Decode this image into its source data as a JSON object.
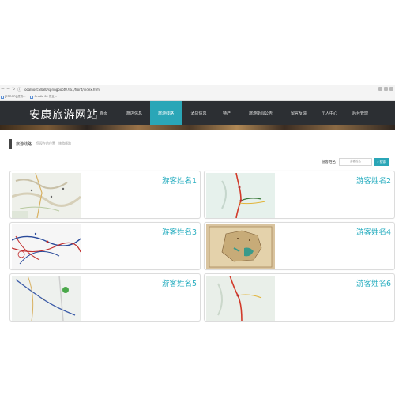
{
  "browser": {
    "url": "localhost:8080/springboot07la1/front/index.html",
    "nav_icons": [
      "back-icon",
      "forward-icon",
      "reload-icon",
      "info-icon"
    ],
    "bookmarks": [
      {
        "label": "[ERROR] 资讯..."
      },
      {
        "label": "Gradle 00 作业..."
      }
    ]
  },
  "site": {
    "logo": "安康旅游网站",
    "menu": [
      {
        "label": "首页",
        "active": false
      },
      {
        "label": "旅店信息",
        "active": false
      },
      {
        "label": "旅游线路",
        "active": true
      },
      {
        "label": "酒店信息",
        "active": false
      },
      {
        "label": "特产",
        "active": false
      },
      {
        "label": "旅游新闻公告",
        "active": false
      },
      {
        "label": "留言反馈",
        "active": false
      },
      {
        "label": "个人中心",
        "active": false
      },
      {
        "label": "后台管理",
        "active": false
      }
    ],
    "accent": "#2aa6b7"
  },
  "breadcrumb": {
    "main": "旅游线路",
    "items": [
      "您现在的位置",
      "旅游线路"
    ]
  },
  "search": {
    "label": "游客姓名",
    "placeholder": "游客姓名",
    "button": "搜索",
    "button_icon": "search-icon"
  },
  "cards": [
    {
      "title": "游客姓名1"
    },
    {
      "title": "游客姓名2"
    },
    {
      "title": "游客姓名3"
    },
    {
      "title": "游客姓名4"
    },
    {
      "title": "游客姓名5"
    },
    {
      "title": "游客姓名6"
    }
  ]
}
